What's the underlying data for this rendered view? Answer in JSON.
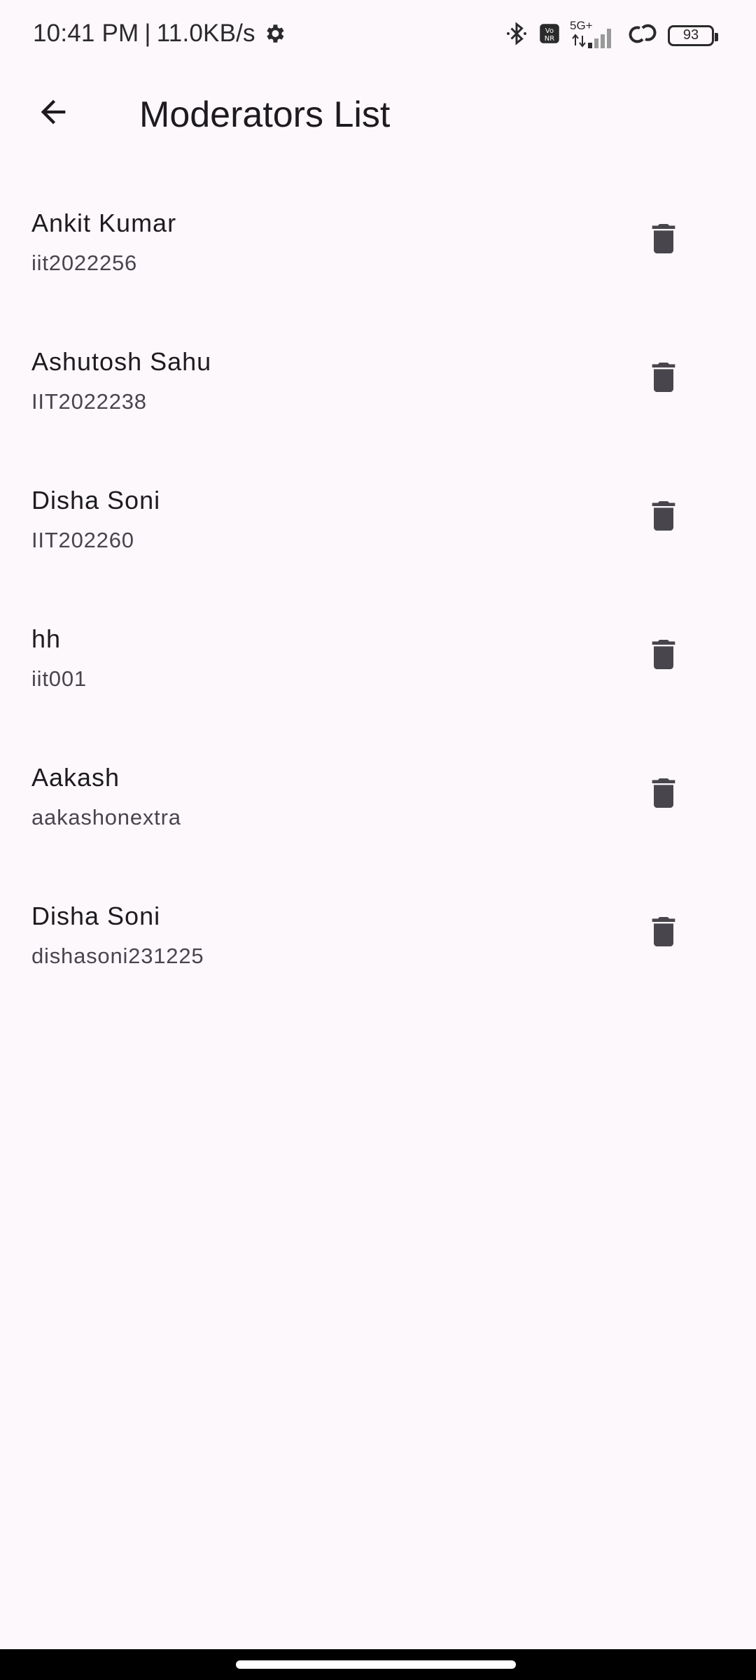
{
  "status_bar": {
    "time": "10:41 PM",
    "separator": "|",
    "network_speed": "11.0KB/s",
    "network_type": "5G+",
    "battery_level": "93",
    "icons": [
      "gear-icon",
      "bluetooth-icon",
      "vonr-icon",
      "signal-icon",
      "link-icon",
      "battery-icon"
    ]
  },
  "app_bar": {
    "title": "Moderators List",
    "back_icon": "arrow-back-icon"
  },
  "moderators": [
    {
      "name": "Ankit Kumar",
      "id": "iit2022256"
    },
    {
      "name": "Ashutosh Sahu",
      "id": "IIT2022238"
    },
    {
      "name": "Disha Soni",
      "id": "IIT202260"
    },
    {
      "name": "hh",
      "id": "iit001"
    },
    {
      "name": "Aakash",
      "id": "aakashonextra"
    },
    {
      "name": "Disha Soni",
      "id": "dishasoni231225"
    }
  ],
  "colors": {
    "background": "#fdf8fc",
    "text_primary": "#1d1b20",
    "text_secondary": "#49454f",
    "icon": "#48464c"
  }
}
